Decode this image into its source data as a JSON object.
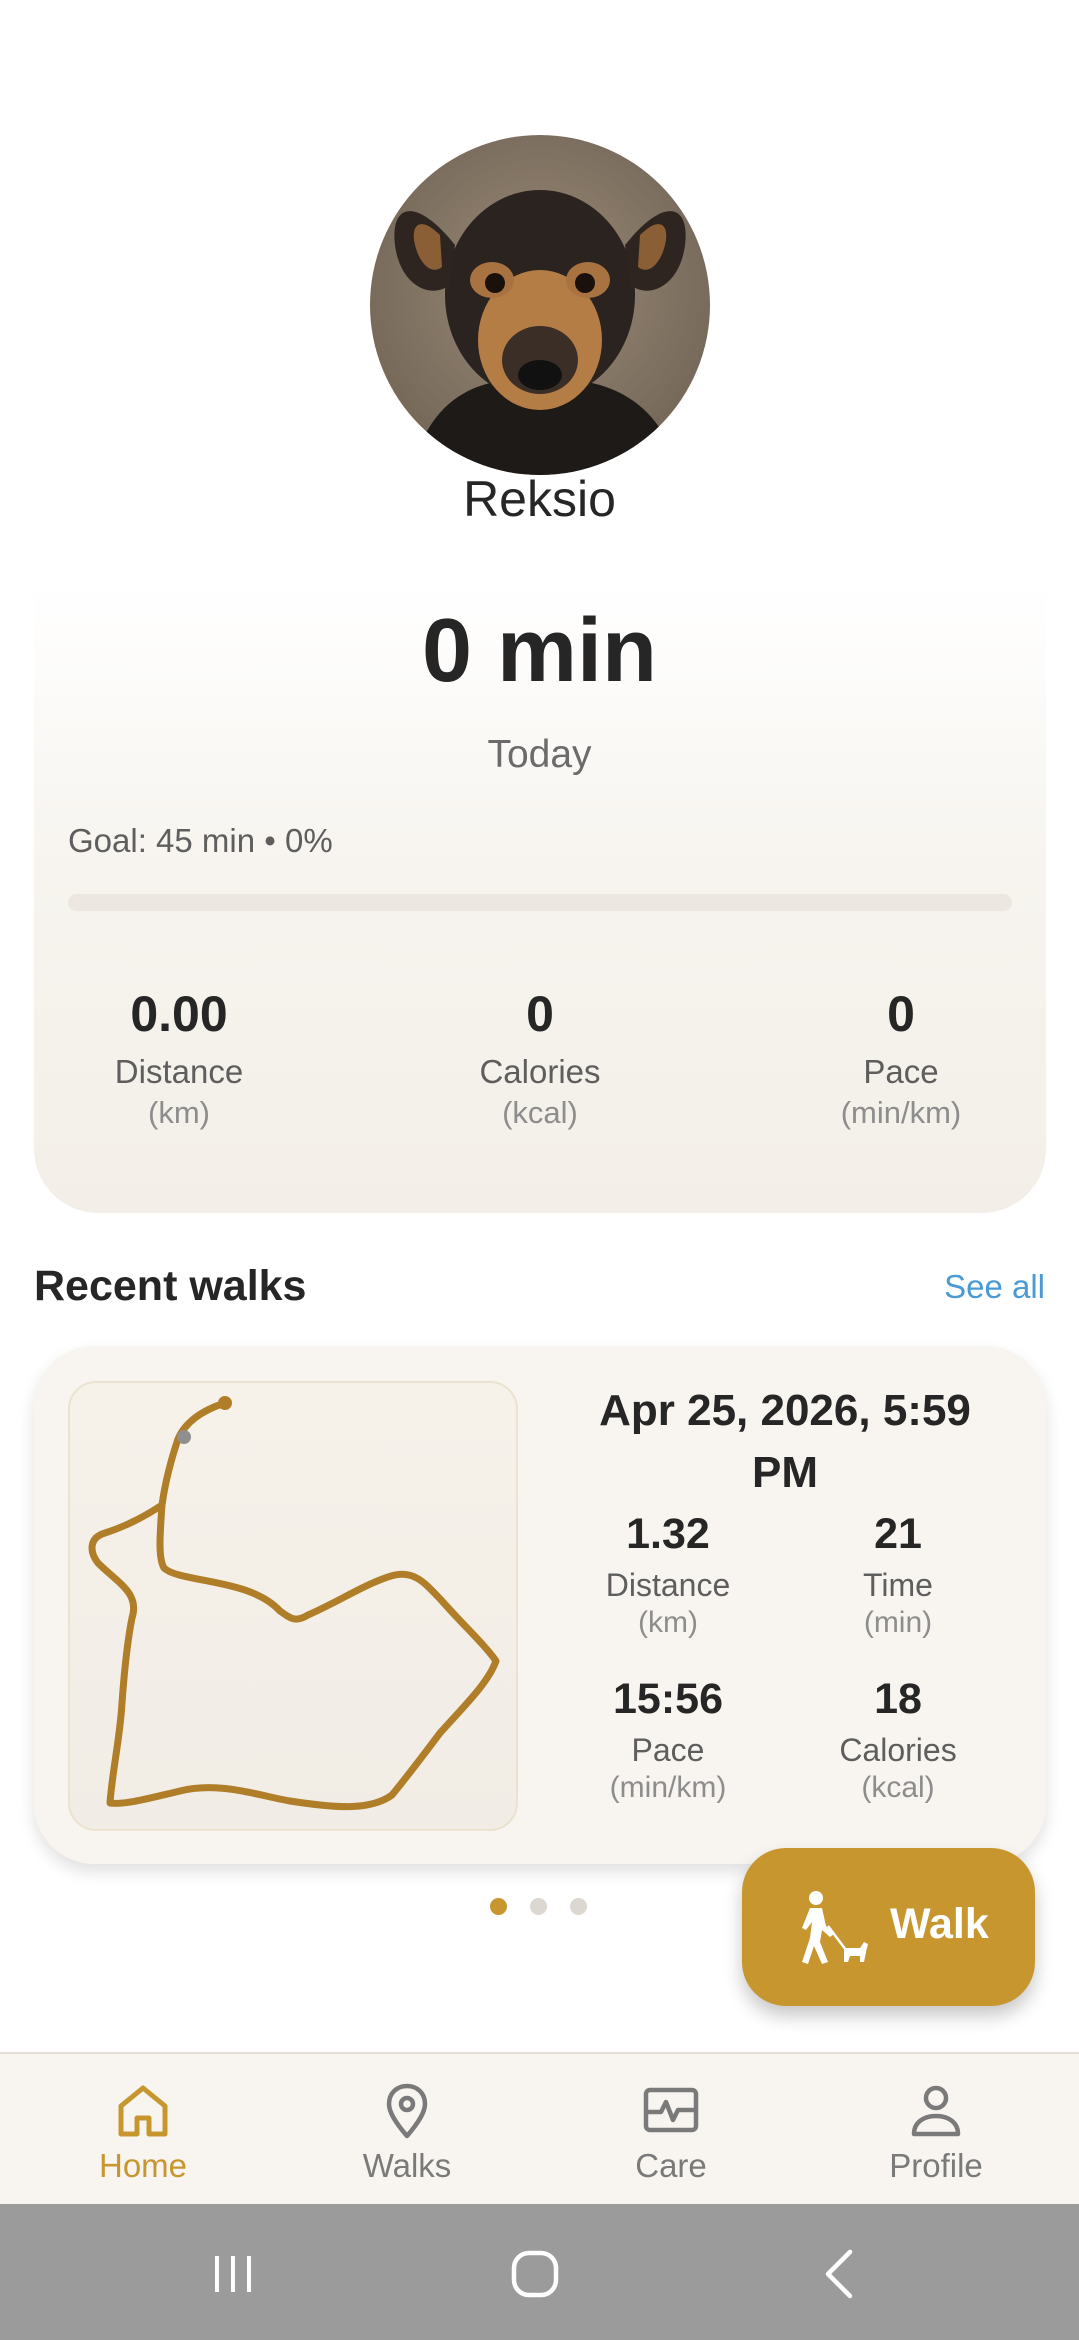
{
  "profile": {
    "name": "Reksio"
  },
  "summary": {
    "minutes": "0 min",
    "period": "Today",
    "goal_text": "Goal: 45 min • 0%",
    "goal_progress": 0,
    "stats": [
      {
        "value": "0.00",
        "label": "Distance",
        "unit": "(km)"
      },
      {
        "value": "0",
        "label": "Calories",
        "unit": "(kcal)"
      },
      {
        "value": "0",
        "label": "Pace",
        "unit": "(min/km)"
      }
    ]
  },
  "recent": {
    "title": "Recent walks",
    "see_all": "See all",
    "walk": {
      "date": "Apr 25, 2026, 5:59 PM",
      "stats": [
        {
          "value": "1.32",
          "label": "Distance",
          "unit": "(km)"
        },
        {
          "value": "21",
          "label": "Time",
          "unit": "(min)"
        },
        {
          "value": "15:56",
          "label": "Pace",
          "unit": "(min/km)"
        },
        {
          "value": "18",
          "label": "Calories",
          "unit": "(kcal)"
        }
      ]
    },
    "pager": {
      "count": 3,
      "active": 0
    }
  },
  "fab": {
    "label": "Walk",
    "icon": "person-walking-dog-icon"
  },
  "nav": [
    {
      "label": "Home",
      "icon": "home-icon",
      "active": true
    },
    {
      "label": "Walks",
      "icon": "map-pin-icon",
      "active": false
    },
    {
      "label": "Care",
      "icon": "heartbeat-monitor-icon",
      "active": false
    },
    {
      "label": "Profile",
      "icon": "person-icon",
      "active": false
    }
  ],
  "colors": {
    "accent": "#c8962f",
    "link": "#4a9ad6",
    "route": "#b07d28"
  },
  "system_nav": [
    "recents-icon",
    "home-circle-icon",
    "back-icon"
  ]
}
